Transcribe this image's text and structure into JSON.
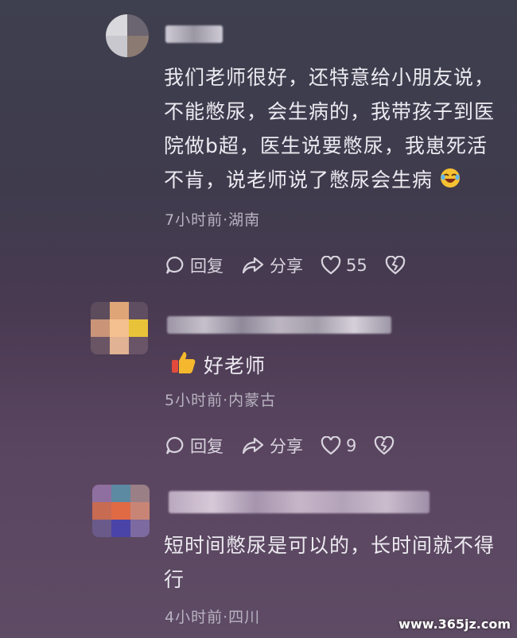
{
  "comments": [
    {
      "text_lines": [
        "我们老师很好，还特意给小朋友说，",
        "不能憋尿，会生病的，我带孩子到医",
        "院做b超，医生说要憋尿，我崽死活",
        "不肯，说老师说了憋尿会生病"
      ],
      "emoji": "laughing-emoji",
      "meta": "7小时前·湖南",
      "reply_label": "回复",
      "share_label": "分享",
      "like_count": "55"
    },
    {
      "text": "好老师",
      "emoji": "thumbs-up-emoji",
      "meta": "5小时前·内蒙古",
      "reply_label": "回复",
      "share_label": "分享",
      "like_count": "9"
    },
    {
      "text_lines": [
        "短时间憋尿是可以的，长时间就不得",
        "行"
      ],
      "meta": "4小时前·四川"
    }
  ],
  "watermark": "www.365jz.com"
}
